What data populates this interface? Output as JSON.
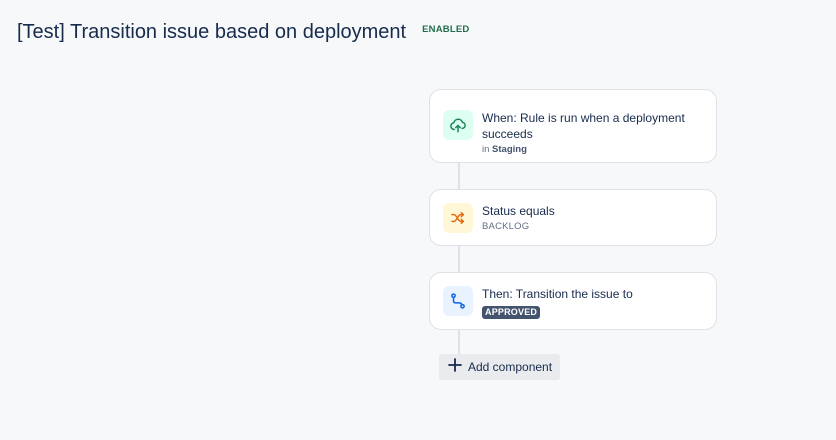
{
  "header": {
    "title": "[Test] Transition issue based on deployment",
    "status_badge": "ENABLED"
  },
  "flow": {
    "trigger": {
      "icon": "cloud-upload-icon",
      "title_line1": "When: Rule is run when a deployment",
      "title_line2": "succeeds",
      "prefix": "in",
      "environment": "Staging"
    },
    "condition": {
      "icon": "shuffle-icon",
      "title": "Status equals",
      "value": "BACKLOG"
    },
    "action": {
      "icon": "transition-icon",
      "title": "Then: Transition the issue to",
      "value": "APPROVED"
    },
    "add_component_label": "Add component"
  },
  "colors": {
    "background": "#f7f8f9",
    "trigger_icon": "#1f845a",
    "condition_icon": "#e56910",
    "action_icon": "#0c66e4",
    "enabled_badge": "#216e4e"
  }
}
